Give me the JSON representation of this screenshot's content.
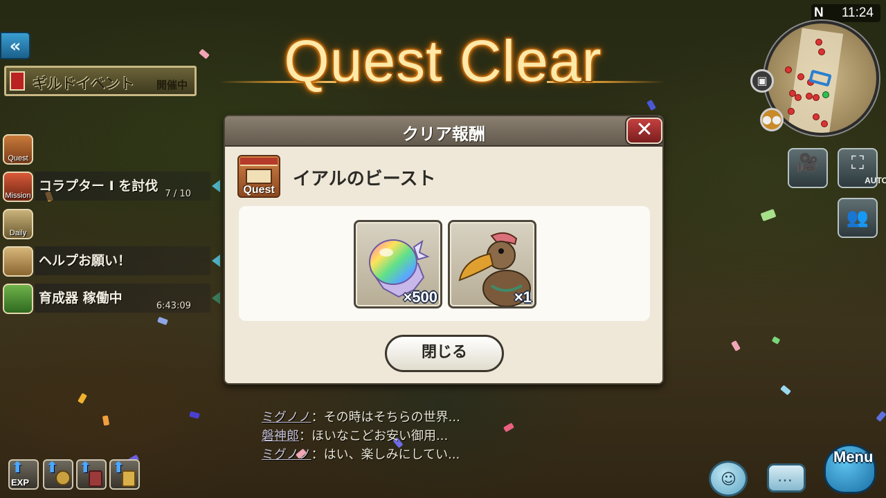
{
  "title": "Quest Clear",
  "clock": {
    "compass": "N",
    "time": "11:24"
  },
  "left_panel": {
    "back_icon": "double-chevron-left-icon",
    "guild_event": {
      "label": "ギルドイベント",
      "status": "開催中"
    },
    "side_icons": [
      {
        "label": "Quest"
      },
      {
        "label": "Mission"
      },
      {
        "label": "Daily"
      }
    ],
    "tasks": [
      {
        "text": "コラプター I を討伐",
        "sub": "7 / 10"
      },
      {
        "text": "ヘルプお願い！",
        "sub": ""
      },
      {
        "text": "育成器 稼働中",
        "sub": "6:43:09"
      }
    ]
  },
  "right_panel": {
    "camera_icon": "camera-icon",
    "auto_label": "AUTO",
    "party_icon": "party-icon"
  },
  "dialog": {
    "title": "クリア報酬",
    "close_icon": "close-icon",
    "quest_icon_label": "Quest",
    "quest_name": "イアルのビースト",
    "rewards": [
      {
        "icon": "rainbow-crystal-icon",
        "quantity": "×500"
      },
      {
        "icon": "dodo-bird-icon",
        "quantity": "×1"
      }
    ],
    "close_button": "閉じる"
  },
  "chat": [
    {
      "name": "ミグノノ",
      "message": "：その時はそちらの世界..."
    },
    {
      "name": "磐神郎",
      "message": "：ほいなこどお安い御用..."
    },
    {
      "name": "ミグノノ",
      "message": "：はい、楽しみにしてい..."
    }
  ],
  "bottom_bar": {
    "exp_label": "EXP",
    "menu_label": "Menu"
  }
}
